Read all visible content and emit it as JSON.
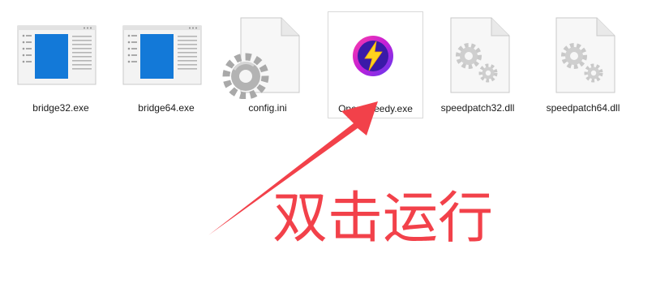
{
  "files": [
    {
      "name": "bridge32.exe",
      "icon": "app-window-icon"
    },
    {
      "name": "bridge64.exe",
      "icon": "app-window-icon"
    },
    {
      "name": "config.ini",
      "icon": "settings-file-icon"
    },
    {
      "name": "OpenSpeedy.exe",
      "icon": "openspeedy-lightning-icon",
      "selected": true
    },
    {
      "name": "speedpatch32.dll",
      "icon": "dll-gears-icon"
    },
    {
      "name": "speedpatch64.dll",
      "icon": "dll-gears-icon"
    }
  ],
  "annotation": {
    "text": "双击运行",
    "color": "#f2414a",
    "arrow_icon": "red-arrow-icon"
  },
  "colors": {
    "window_blue": "#1379d8",
    "lightning_ring": "#c21ed8",
    "lightning_bolt": "#ffd21e"
  }
}
